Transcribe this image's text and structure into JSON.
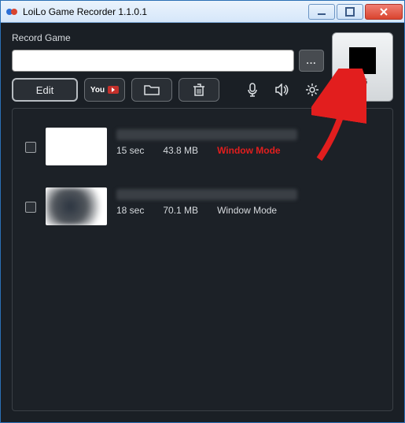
{
  "window": {
    "title": "LoiLo Game Recorder 1.1.0.1"
  },
  "labels": {
    "record_game": "Record Game"
  },
  "path": {
    "value": "",
    "browse": "..."
  },
  "toolbar": {
    "edit": "Edit",
    "youtube": "Tube"
  },
  "record": {
    "hotkey": "F6"
  },
  "list": [
    {
      "duration": "15 sec",
      "size": "43.8 MB",
      "mode": "Window Mode",
      "highlight": true
    },
    {
      "duration": "18 sec",
      "size": "70.1 MB",
      "mode": "Window Mode",
      "highlight": false
    }
  ]
}
